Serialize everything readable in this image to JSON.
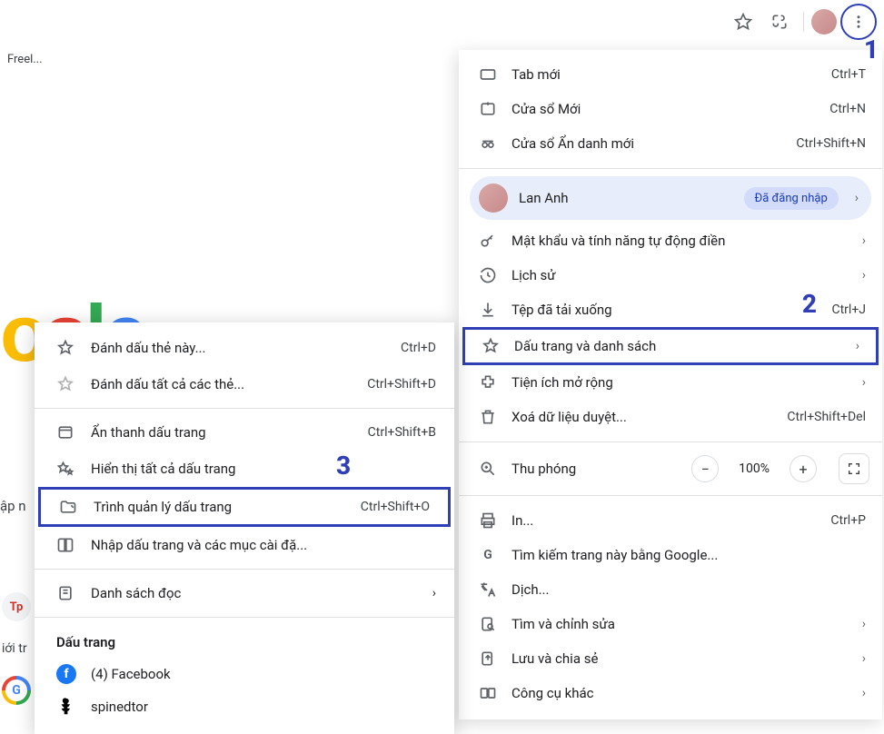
{
  "toolbar": {
    "bookmark_bar_text": "Freel..."
  },
  "page": {
    "search_hint": "ập n",
    "left_text": "iới tr"
  },
  "annotations": {
    "n1": "1",
    "n2": "2",
    "n3": "3"
  },
  "menu": {
    "new_tab": {
      "label": "Tab mới",
      "shortcut": "Ctrl+T"
    },
    "new_window": {
      "label": "Cửa sổ Mới",
      "shortcut": "Ctrl+N"
    },
    "incognito": {
      "label": "Cửa sổ Ẩn danh mới",
      "shortcut": "Ctrl+Shift+N"
    },
    "profile": {
      "name": "Lan Anh",
      "status": "Đã đăng nhập"
    },
    "passwords": {
      "label": "Mật khẩu và tính năng tự động điền"
    },
    "history": {
      "label": "Lịch sử"
    },
    "downloads": {
      "label": "Tệp đã tải xuống",
      "shortcut": "Ctrl+J"
    },
    "bookmarks": {
      "label": "Dấu trang và danh sách"
    },
    "extensions": {
      "label": "Tiện ích mở rộng"
    },
    "clear_data": {
      "label": "Xoá dữ liệu duyệt...",
      "shortcut": "Ctrl+Shift+Del"
    },
    "zoom": {
      "label": "Thu phóng",
      "value": "100%"
    },
    "print": {
      "label": "In...",
      "shortcut": "Ctrl+P"
    },
    "search_google": {
      "label": "Tìm kiếm trang này bằng Google..."
    },
    "translate": {
      "label": "Dịch..."
    },
    "find_edit": {
      "label": "Tìm và chỉnh sửa"
    },
    "save_share": {
      "label": "Lưu và chia sẻ"
    },
    "more_tools": {
      "label": "Công cụ khác"
    }
  },
  "submenu": {
    "bookmark_tab": {
      "label": "Đánh dấu thẻ này...",
      "shortcut": "Ctrl+D"
    },
    "bookmark_all": {
      "label": "Đánh dấu tất cả các thẻ...",
      "shortcut": "Ctrl+Shift+D"
    },
    "hide_bar": {
      "label": "Ẩn thanh dấu trang",
      "shortcut": "Ctrl+Shift+B"
    },
    "show_all": {
      "label": "Hiển thị tất cả dấu trang"
    },
    "manager": {
      "label": "Trình quản lý dấu trang",
      "shortcut": "Ctrl+Shift+O"
    },
    "import": {
      "label": "Nhập dấu trang và các mục cài đặ..."
    },
    "reading_list": {
      "label": "Danh sách đọc"
    },
    "heading": "Dấu trang",
    "bookmarks": [
      {
        "label": "(4) Facebook",
        "icon": "facebook"
      },
      {
        "label": "spinedtor",
        "icon": "spine"
      }
    ]
  }
}
